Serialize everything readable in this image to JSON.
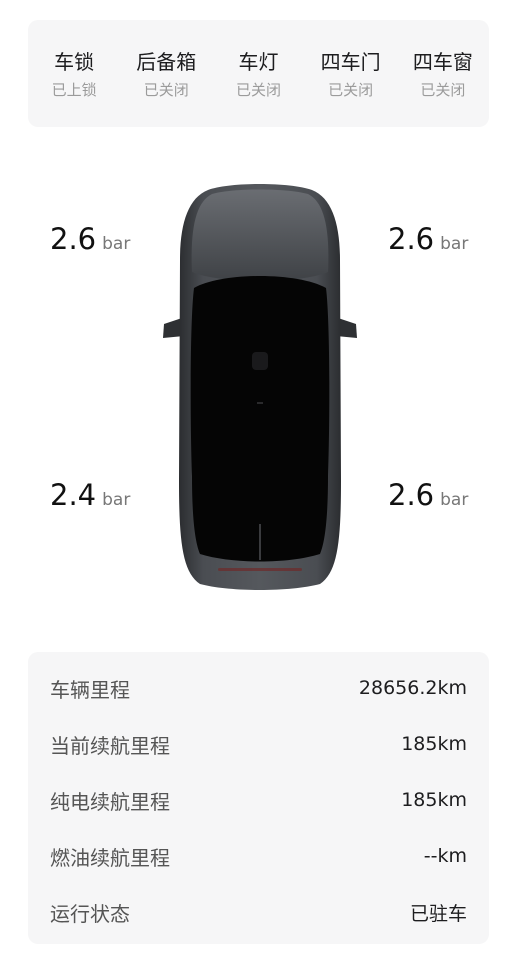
{
  "status": [
    {
      "label": "车锁",
      "value": "已上锁"
    },
    {
      "label": "后备箱",
      "value": "已关闭"
    },
    {
      "label": "车灯",
      "value": "已关闭"
    },
    {
      "label": "四车门",
      "value": "已关闭"
    },
    {
      "label": "四车窗",
      "value": "已关闭"
    }
  ],
  "tires": {
    "front_left": {
      "value": "2.6",
      "unit": "bar"
    },
    "front_right": {
      "value": "2.6",
      "unit": "bar"
    },
    "rear_left": {
      "value": "2.4",
      "unit": "bar"
    },
    "rear_right": {
      "value": "2.6",
      "unit": "bar"
    }
  },
  "stats": [
    {
      "label": "车辆里程",
      "value": "28656.2km"
    },
    {
      "label": "当前续航里程",
      "value": "185km"
    },
    {
      "label": "纯电续航里程",
      "value": "185km"
    },
    {
      "label": "燃油续航里程",
      "value": "--km"
    },
    {
      "label": "运行状态",
      "value": "已驻车"
    }
  ],
  "colors": {
    "card_bg": "#f6f6f7",
    "car_body": "#3d4044",
    "car_glass": "#050505"
  }
}
